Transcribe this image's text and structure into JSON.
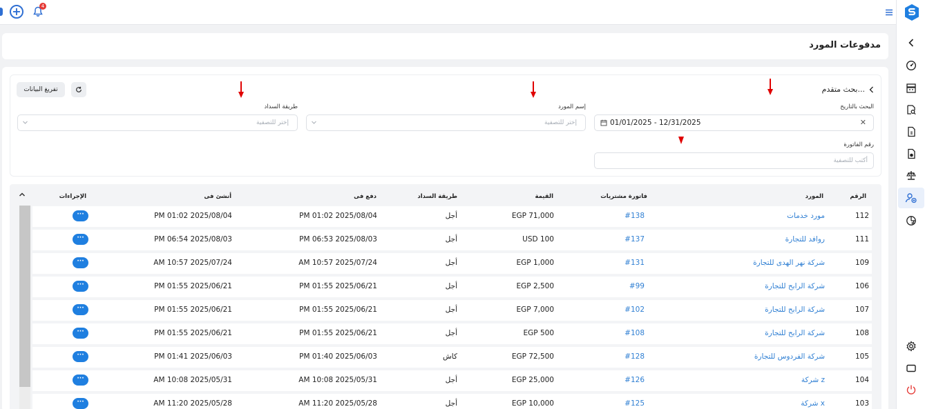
{
  "topbar": {
    "notification_count": "4"
  },
  "page": {
    "title": "مدفوعات المورد"
  },
  "filters": {
    "advanced_search": "بحث متقدم...",
    "clear_button": "تفريغ البيانات",
    "date_label": "البحث بالتاريخ",
    "date_value": "01/01/2025 - 12/31/2025",
    "supplier_label": "إسم المورد",
    "supplier_placeholder": "إختر للتصفية",
    "payment_method_label": "طريقة السداد",
    "payment_method_placeholder": "إختر للتصفية",
    "invoice_label": "رقم الفاتورة",
    "invoice_placeholder": "أكتب للتصفية"
  },
  "table": {
    "headers": {
      "number": "الرقم",
      "supplier": "المورد",
      "purchase_invoice": "فاتورة مشتريات",
      "amount": "القيمة",
      "payment_method": "طريقة السداد",
      "paid_on": "دفع فى",
      "created_on": "أنشئ فى",
      "actions": "الإجراءات"
    },
    "action_label": "···",
    "rows": [
      {
        "number": "112",
        "supplier": "مورد خدمات",
        "invoice": "#138",
        "amount": "EGP 71,000",
        "method": "أجل",
        "paid_on": "PM 01:02 2025/08/04",
        "created_on": "PM 01:02 2025/08/04"
      },
      {
        "number": "111",
        "supplier": "روافد للتجارة",
        "invoice": "#137",
        "amount": "USD 100",
        "method": "أجل",
        "paid_on": "PM 06:53 2025/08/03",
        "created_on": "PM 06:54 2025/08/03"
      },
      {
        "number": "109",
        "supplier": "شركة  نهر الهدى للتجارة",
        "invoice": "#131",
        "amount": "EGP 1,000",
        "method": "أجل",
        "paid_on": "AM 10:57 2025/07/24",
        "created_on": "AM 10:57 2025/07/24"
      },
      {
        "number": "106",
        "supplier": "شركة الرابح للتجارة",
        "invoice": "#99",
        "amount": "EGP 2,500",
        "method": "أجل",
        "paid_on": "PM 01:55 2025/06/21",
        "created_on": "PM 01:55 2025/06/21"
      },
      {
        "number": "107",
        "supplier": "شركة الرابح للتجارة",
        "invoice": "#102",
        "amount": "EGP 7,000",
        "method": "أجل",
        "paid_on": "PM 01:55 2025/06/21",
        "created_on": "PM 01:55 2025/06/21"
      },
      {
        "number": "108",
        "supplier": "شركة الرابح للتجارة",
        "invoice": "#108",
        "amount": "EGP 500",
        "method": "أجل",
        "paid_on": "PM 01:55 2025/06/21",
        "created_on": "PM 01:55 2025/06/21"
      },
      {
        "number": "105",
        "supplier": "شركة الفردوس للتجارة",
        "invoice": "#128",
        "amount": "EGP 72,500",
        "method": "كاش",
        "paid_on": "PM 01:40 2025/06/03",
        "created_on": "PM 01:41 2025/06/03"
      },
      {
        "number": "104",
        "supplier": "شركة z",
        "invoice": "#126",
        "amount": "EGP 25,000",
        "method": "أجل",
        "paid_on": "AM 10:08 2025/05/31",
        "created_on": "AM 10:08 2025/05/31"
      },
      {
        "number": "103",
        "supplier": "شركة x",
        "invoice": "#125",
        "amount": "EGP 10,000",
        "method": "أجل",
        "paid_on": "AM 11:20 2025/05/28",
        "created_on": "AM 11:20 2025/05/28"
      }
    ]
  },
  "colors": {
    "accent": "#1f7fe0",
    "link": "#2f7fd3",
    "annotation_arrow": "#e00000",
    "logout": "#e53935"
  }
}
